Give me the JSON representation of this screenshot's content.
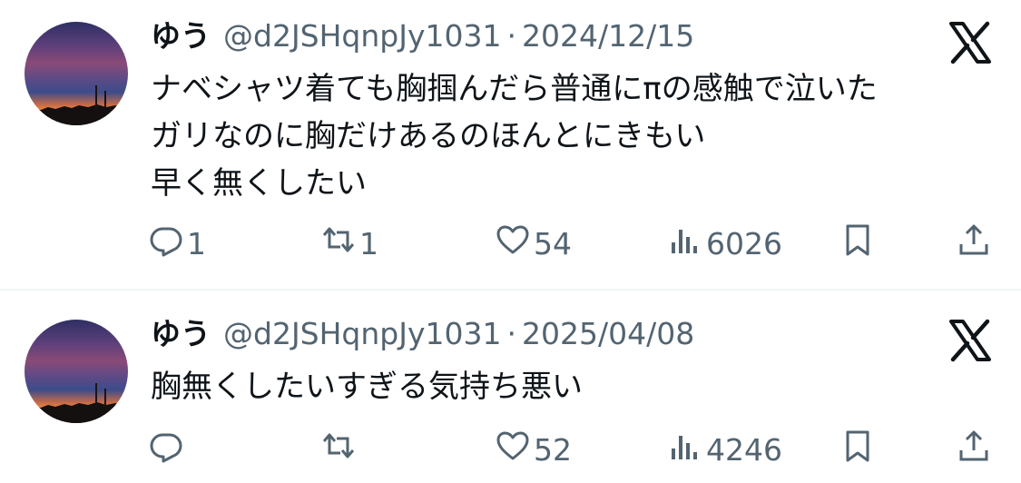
{
  "tweets": [
    {
      "name": "ゆう",
      "handle": "@d2JSHqnpJy1031",
      "separator": "·",
      "date": "2024/12/15",
      "text": "ナベシャツ着ても胸掴んだら普通にπの感触で泣いた\nガリなのに胸だけあるのほんとにきもい\n早く無くしたい",
      "replies": "1",
      "reposts": "1",
      "likes": "54",
      "views": "6026"
    },
    {
      "name": "ゆう",
      "handle": "@d2JSHqnpJy1031",
      "separator": "·",
      "date": "2025/04/08",
      "text": "胸無くしたいすぎる気持ち悪い",
      "replies": "",
      "reposts": "",
      "likes": "52",
      "views": "4246"
    }
  ],
  "icons": {
    "brand": "x-logo-icon",
    "reply": "reply-icon",
    "repost": "repost-icon",
    "like": "heart-icon",
    "views": "views-icon",
    "bookmark": "bookmark-icon",
    "share": "share-icon"
  },
  "colors": {
    "text": "#0f1419",
    "secondary": "#536471",
    "divider": "#eff3f4"
  }
}
